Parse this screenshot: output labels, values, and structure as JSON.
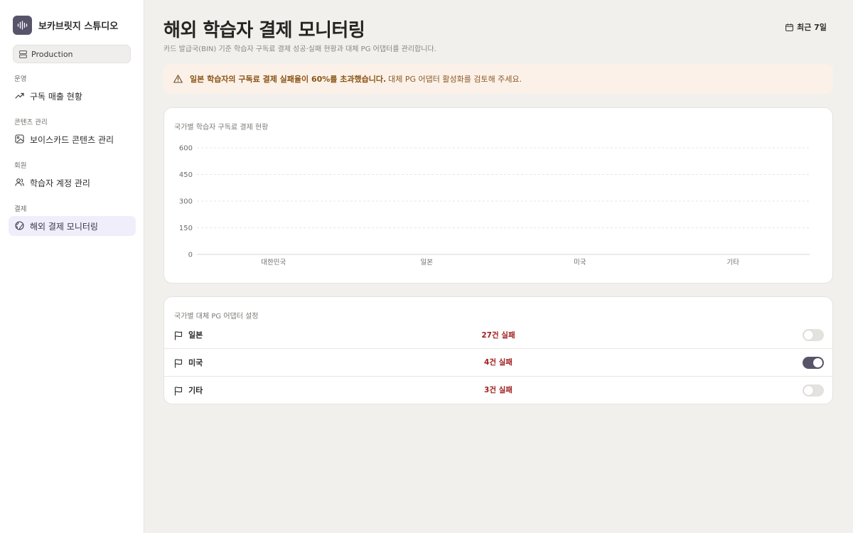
{
  "brand": {
    "name": "보카브릿지 스튜디오",
    "logo_icon": "waveform-icon"
  },
  "environment": {
    "label": "Production",
    "icon": "server-icon"
  },
  "nav": {
    "sections": [
      {
        "label": "운영",
        "items": [
          {
            "label": "구독 매출 현황",
            "icon": "trending-up-icon"
          }
        ]
      },
      {
        "label": "콘텐츠 관리",
        "items": [
          {
            "label": "보이스카드 콘텐츠 관리",
            "icon": "image-card-icon"
          }
        ]
      },
      {
        "label": "회원",
        "items": [
          {
            "label": "학습자 계정 관리",
            "icon": "users-icon"
          }
        ]
      },
      {
        "label": "결제",
        "items": [
          {
            "label": "해외 결제 모니터링",
            "icon": "globe-icon",
            "active": true
          }
        ]
      }
    ]
  },
  "header": {
    "title": "해외 학습자 결제 모니터링",
    "subtitle": "카드 발급국(BIN) 기준 학습자 구독료 결제 성공·실패 현황과 대체 PG 어댑터를 관리합니다.",
    "range_label": "최근 7일"
  },
  "alert": {
    "strong": "일본 학습자의 구독료 결제 실패율이 60%를 초과했습니다.",
    "rest": "대체 PG 어댑터 활성화를 검토해 주세요."
  },
  "chart_section": {
    "title": "국가별 학습자 구독료 결제 현황"
  },
  "chart_data": {
    "type": "bar",
    "categories": [
      "대한민국",
      "일본",
      "미국",
      "기타"
    ],
    "series": [],
    "ylim": [
      0,
      600
    ],
    "yticks": [
      0,
      150,
      300,
      450,
      600
    ],
    "grid": true
  },
  "pg_section": {
    "title": "국가별 대체 PG 어댑터 설정",
    "rows": [
      {
        "country": "일본",
        "fail_text": "27건 실패",
        "enabled": false
      },
      {
        "country": "미국",
        "fail_text": "4건 실패",
        "enabled": true
      },
      {
        "country": "기타",
        "fail_text": "3건 실패",
        "enabled": false
      }
    ]
  },
  "colors": {
    "accent": "#57546a",
    "alert_bg": "#fbf1e8",
    "alert_text": "#8a5416",
    "fail_text": "#a01e1e",
    "active_nav_bg": "#f1eefb"
  }
}
